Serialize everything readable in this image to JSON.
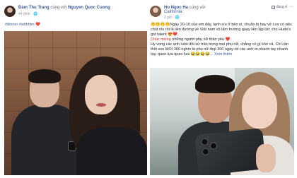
{
  "left_post": {
    "author": "Đàm Thu Trang",
    "with_text": "cùng với",
    "tagged": "Nguyen Quoc Cuong",
    "time": "44 phút",
    "caption_tags": "#dinner #withhim",
    "heart": "❤️"
  },
  "right_post": {
    "author": "Ho Ngoc Ha",
    "with_text": "cùng với",
    "location": "California.",
    "time": "2 giờ",
    "follow_label": "đang d",
    "line1": "🤭🤭🤭🤭Ngày 20-10 của em đây, lạnh xíu ở bên ni, chuẩn bị bay về Los có việc chút xíu rồi là liền đường về Việt nam vô lăm trường quay liền lập tức cho Hude's got talent 😍❤️",
    "line2_red": "Chúc mừng",
    "line2_rest": " những người phụ nữ thân yêu ❤️",
    "line3": "Hy vọng các anh luôn đối xử trân trọng mọi phụ nữ, chẳng có gì khó cả. Chỉ cần thôi son MOI 300 nghìn là phụ nữ đẹp 300 ngày rồi các anh ơi.nhanh tay nhanh tay, quẹo lựa quẹo lựa 😂😂😂😂...",
    "see_more": "Xem thêm"
  },
  "colors": {
    "link": "#385898",
    "text": "#1c1e21",
    "muted": "#90949c",
    "accent_red": "#d62828"
  }
}
